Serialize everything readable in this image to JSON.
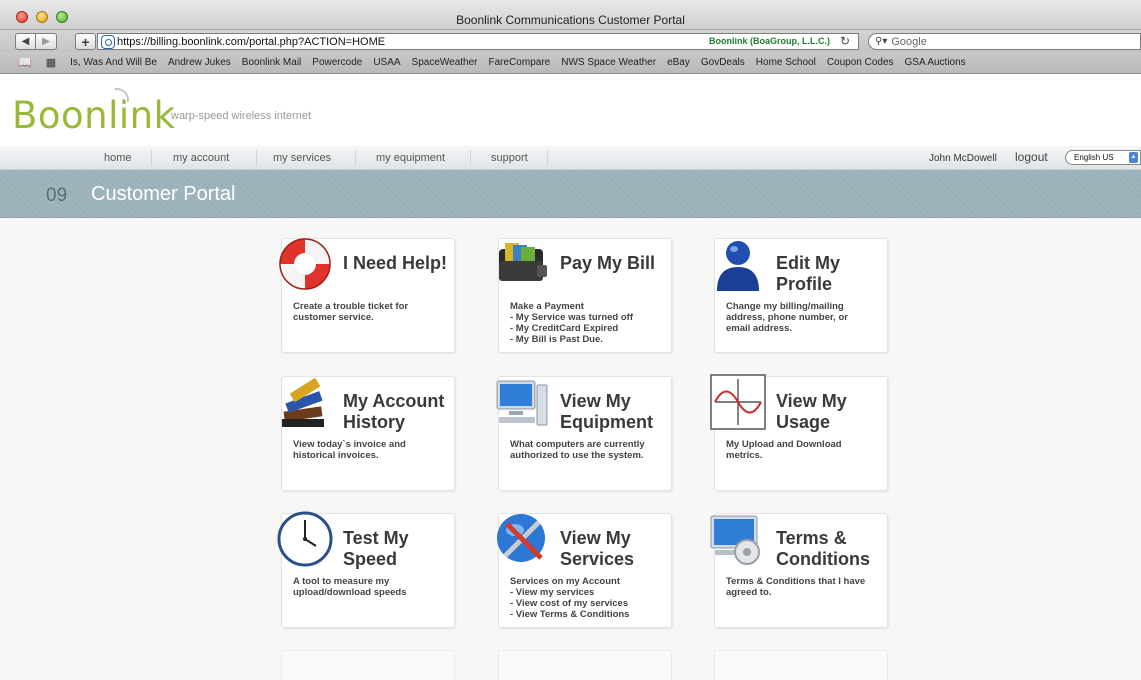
{
  "browser": {
    "window_title": "Boonlink Communications Customer Portal",
    "url": "https://billing.boonlink.com/portal.php?ACTION=HOME",
    "cert_label": "Boonlink (BoaGroup, L.L.C.)",
    "search_placeholder": "Google",
    "back_label": "◀",
    "forward_label": "▶",
    "plus_label": "+",
    "reload_label": "↻",
    "bookmarks": [
      "Is, Was And Will Be",
      "Andrew Jukes",
      "Boonlink Mail",
      "Powercode",
      "USAA",
      "SpaceWeather",
      "FareCompare",
      "NWS Space Weather",
      "eBay",
      "GovDeals",
      "Home School",
      "Coupon Codes",
      "GSA Auctions"
    ]
  },
  "site": {
    "logo": "Boonlink",
    "tagline": "warp-speed wireless internet",
    "nav": [
      "home",
      "my account",
      "my services",
      "my equipment",
      "support"
    ],
    "user_name": "John McDowell",
    "logout_label": "logout",
    "language": "English US"
  },
  "banner": {
    "number": "09",
    "title": "Customer Portal"
  },
  "tiles": [
    {
      "title": "I Need Help!",
      "desc": "Create a trouble ticket for\ncustomer service.",
      "icon": "lifebuoy-icon"
    },
    {
      "title": "Pay My Bill",
      "desc": "Make a Payment\n- My Service was turned off\n- My CreditCard Expired\n- My Bill is Past Due.",
      "icon": "wallet-icon"
    },
    {
      "title": "Edit My Profile",
      "desc": "Change my billing/mailing\naddress, phone number, or\nemail address.",
      "icon": "person-icon"
    },
    {
      "title": "My Account History",
      "desc": "View today`s invoice and\nhistorical invoices.",
      "icon": "books-icon"
    },
    {
      "title": "View My Equipment",
      "desc": "What computers are currently\nauthorized to use the system.",
      "icon": "computer-icon"
    },
    {
      "title": "View My Usage",
      "desc": "My Upload and Download\nmetrics.",
      "icon": "sine-graph-icon"
    },
    {
      "title": "Test My Speed",
      "desc": "A tool to measure my\nupload/download speeds",
      "icon": "clock-icon"
    },
    {
      "title": "View My Services",
      "desc": "Services on my Account\n- View my services\n- View cost of my services\n- View Terms & Conditions",
      "icon": "tools-globe-icon"
    },
    {
      "title": "Terms & Conditions",
      "desc": "Terms & Conditions that I have\nagreed to.",
      "icon": "monitor-gear-icon"
    }
  ],
  "colors": {
    "logo_green": "#9ab838",
    "banner": "#a1b5bd",
    "cert_green": "#1d7d2e"
  }
}
